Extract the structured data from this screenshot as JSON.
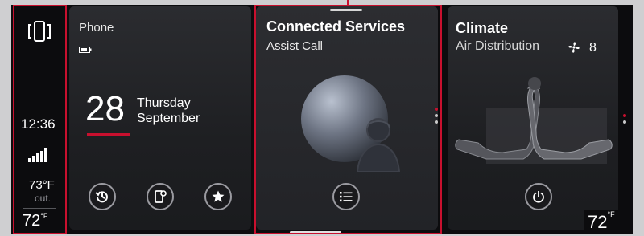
{
  "status": {
    "time": "12:36",
    "outside_temp": "73°F",
    "outside_label": "out.",
    "driver_temp": "72",
    "driver_temp_unit": "°F"
  },
  "phone": {
    "title": "Phone",
    "day_number": "28",
    "weekday": "Thursday",
    "month": "September"
  },
  "connected": {
    "title": "Connected Services",
    "subtitle": "Assist Call"
  },
  "climate": {
    "title": "Climate",
    "subtitle": "Air Distribution",
    "fan_level": "8",
    "passenger_temp": "72",
    "passenger_temp_unit": "°F"
  },
  "colors": {
    "accent_red": "#c8102e"
  }
}
